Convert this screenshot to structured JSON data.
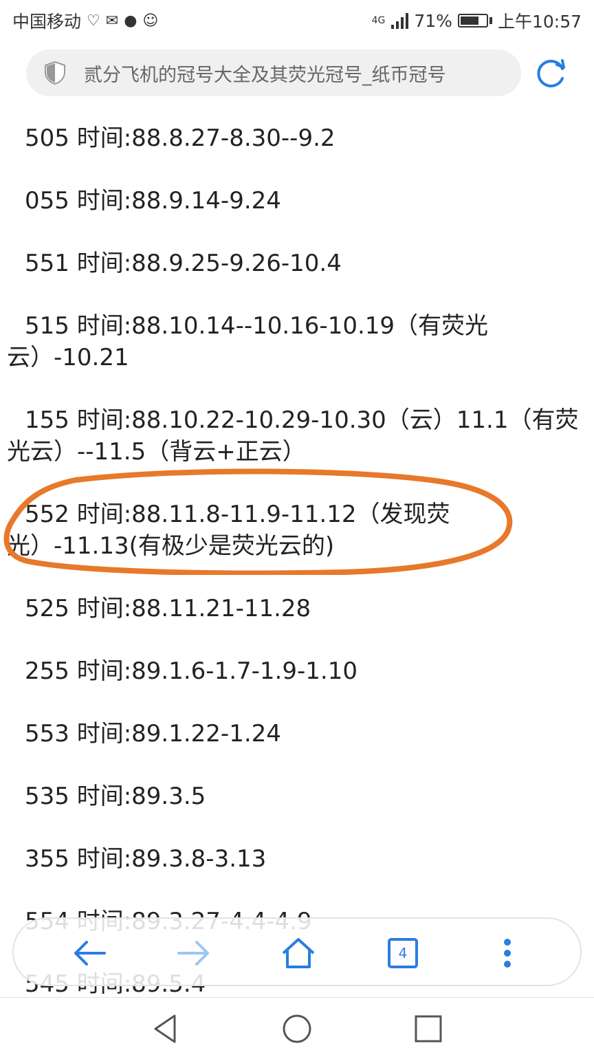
{
  "status_bar": {
    "carrier": "中国移动",
    "signal": "4G",
    "battery_percent": "71%",
    "battery_level": 0.71,
    "time": "上午10:57"
  },
  "browser": {
    "url_title": "贰分飞机的冠号大全及其荧光冠号_纸币冠号",
    "tab_count": "4"
  },
  "entries": [
    {
      "text": "505 时间:88.8.27-8.30--9.2"
    },
    {
      "text": "055 时间:88.9.14-9.24"
    },
    {
      "text": "551 时间:88.9.25-9.26-10.4"
    },
    {
      "text": "515 时间:88.10.14--10.16-10.19（有荧光云）-10.21"
    },
    {
      "text": "155 时间:88.10.22-10.29-10.30（云）11.1（有荧光云）--11.5（背云+正云）"
    },
    {
      "text": "552 时间:88.11.8-11.9-11.12（发现荧光）-11.13(有极少是荧光云的)"
    },
    {
      "text": "525 时间:88.11.21-11.28"
    },
    {
      "text": "255 时间:89.1.6-1.7-1.9-1.10"
    },
    {
      "text": "553 时间:89.1.22-1.24"
    },
    {
      "text": "535 时间:89.3.5"
    },
    {
      "text": "355 时间:89.3.8-3.13"
    },
    {
      "text": "554 时间:89.3.27-4.4-4.9"
    },
    {
      "text": "545 时间:89.5.4"
    }
  ],
  "colors": {
    "accent": "#2a7de1",
    "highlight": "#e8782a"
  }
}
